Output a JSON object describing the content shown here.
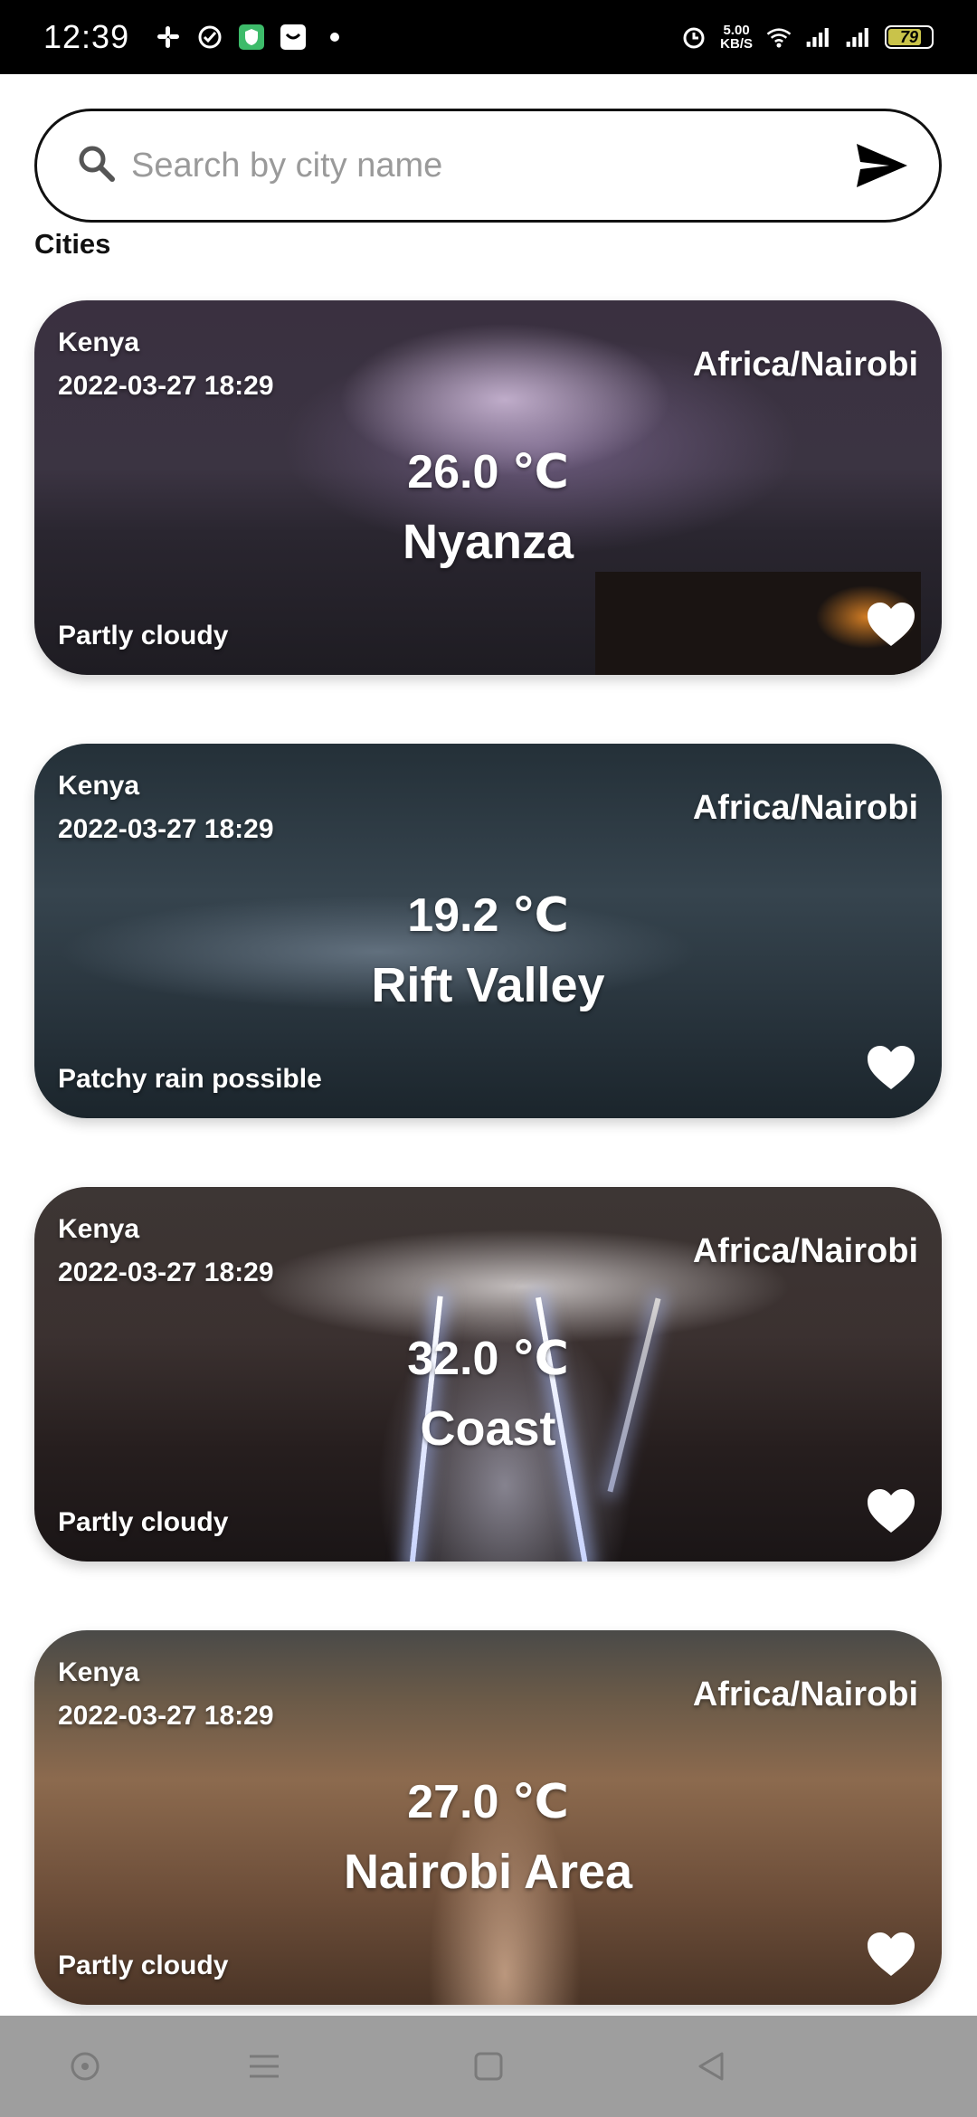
{
  "status_bar": {
    "time": "12:39",
    "speed_value": "5.00",
    "speed_unit": "KB/S",
    "battery": "79",
    "battery_level": 0.79
  },
  "search": {
    "placeholder": "Search by city name",
    "value": ""
  },
  "section_title": "Cities",
  "cards": [
    {
      "country": "Kenya",
      "datetime": "2022-03-27 18:29",
      "timezone": "Africa/Nairobi",
      "temperature": "26.0 ℃",
      "city": "Nyanza",
      "condition": "Partly cloudy"
    },
    {
      "country": "Kenya",
      "datetime": "2022-03-27 18:29",
      "timezone": "Africa/Nairobi",
      "temperature": "19.2 ℃",
      "city": "Rift Valley",
      "condition": "Patchy rain possible"
    },
    {
      "country": "Kenya",
      "datetime": "2022-03-27 18:29",
      "timezone": "Africa/Nairobi",
      "temperature": "32.0 ℃",
      "city": "Coast",
      "condition": "Partly cloudy"
    },
    {
      "country": "Kenya",
      "datetime": "2022-03-27 18:29",
      "timezone": "Africa/Nairobi",
      "temperature": "27.0 ℃",
      "city": "Nairobi Area",
      "condition": "Partly cloudy"
    }
  ],
  "icons": {
    "search": "search-icon",
    "send": "send-icon",
    "favorite": "heart-icon"
  }
}
